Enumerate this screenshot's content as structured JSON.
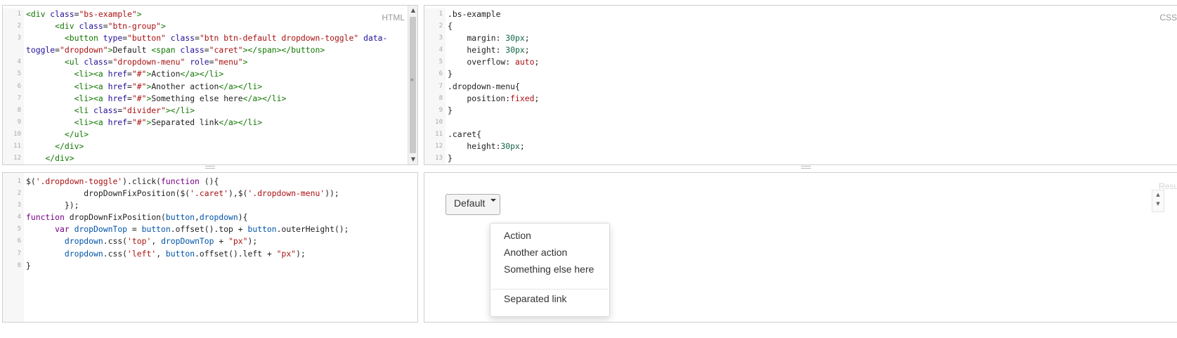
{
  "panes": {
    "html_label": "HTML",
    "css_label": "CSS",
    "result_label": "Resu"
  },
  "html_lines": [
    [
      {
        "c": "t-tag",
        "t": "<div "
      },
      {
        "c": "t-attr",
        "t": "class"
      },
      {
        "c": "t-plain",
        "t": "="
      },
      {
        "c": "t-str",
        "t": "\"bs-example\""
      },
      {
        "c": "t-tag",
        "t": ">"
      }
    ],
    [
      {
        "c": "t-plain",
        "t": "      "
      },
      {
        "c": "t-tag",
        "t": "<div "
      },
      {
        "c": "t-attr",
        "t": "class"
      },
      {
        "c": "t-plain",
        "t": "="
      },
      {
        "c": "t-str",
        "t": "\"btn-group\""
      },
      {
        "c": "t-tag",
        "t": ">"
      }
    ],
    [
      {
        "c": "t-plain",
        "t": "        "
      },
      {
        "c": "t-tag",
        "t": "<button "
      },
      {
        "c": "t-attr",
        "t": "type"
      },
      {
        "c": "t-plain",
        "t": "="
      },
      {
        "c": "t-str",
        "t": "\"button\""
      },
      {
        "c": "t-plain",
        "t": " "
      },
      {
        "c": "t-attr",
        "t": "class"
      },
      {
        "c": "t-plain",
        "t": "="
      },
      {
        "c": "t-str",
        "t": "\"btn btn-default dropdown-toggle\""
      },
      {
        "c": "t-plain",
        "t": " "
      },
      {
        "c": "t-attr",
        "t": "data-"
      }
    ],
    [
      {
        "c": "t-attr",
        "t": "toggle"
      },
      {
        "c": "t-plain",
        "t": "="
      },
      {
        "c": "t-str",
        "t": "\"dropdown\""
      },
      {
        "c": "t-tag",
        "t": ">"
      },
      {
        "c": "t-plain",
        "t": "Default "
      },
      {
        "c": "t-tag",
        "t": "<span "
      },
      {
        "c": "t-attr",
        "t": "class"
      },
      {
        "c": "t-plain",
        "t": "="
      },
      {
        "c": "t-str",
        "t": "\"caret\""
      },
      {
        "c": "t-tag",
        "t": "></span></button>"
      }
    ],
    [
      {
        "c": "t-plain",
        "t": "        "
      },
      {
        "c": "t-tag",
        "t": "<ul "
      },
      {
        "c": "t-attr",
        "t": "class"
      },
      {
        "c": "t-plain",
        "t": "="
      },
      {
        "c": "t-str",
        "t": "\"dropdown-menu\""
      },
      {
        "c": "t-plain",
        "t": " "
      },
      {
        "c": "t-attr",
        "t": "role"
      },
      {
        "c": "t-plain",
        "t": "="
      },
      {
        "c": "t-str",
        "t": "\"menu\""
      },
      {
        "c": "t-tag",
        "t": ">"
      }
    ],
    [
      {
        "c": "t-plain",
        "t": "          "
      },
      {
        "c": "t-tag",
        "t": "<li><a "
      },
      {
        "c": "t-attr",
        "t": "href"
      },
      {
        "c": "t-plain",
        "t": "="
      },
      {
        "c": "t-str",
        "t": "\"#\""
      },
      {
        "c": "t-tag",
        "t": ">"
      },
      {
        "c": "t-plain",
        "t": "Action"
      },
      {
        "c": "t-tag",
        "t": "</a></li>"
      }
    ],
    [
      {
        "c": "t-plain",
        "t": "          "
      },
      {
        "c": "t-tag",
        "t": "<li><a "
      },
      {
        "c": "t-attr",
        "t": "href"
      },
      {
        "c": "t-plain",
        "t": "="
      },
      {
        "c": "t-str",
        "t": "\"#\""
      },
      {
        "c": "t-tag",
        "t": ">"
      },
      {
        "c": "t-plain",
        "t": "Another action"
      },
      {
        "c": "t-tag",
        "t": "</a></li>"
      }
    ],
    [
      {
        "c": "t-plain",
        "t": "          "
      },
      {
        "c": "t-tag",
        "t": "<li><a "
      },
      {
        "c": "t-attr",
        "t": "href"
      },
      {
        "c": "t-plain",
        "t": "="
      },
      {
        "c": "t-str",
        "t": "\"#\""
      },
      {
        "c": "t-tag",
        "t": ">"
      },
      {
        "c": "t-plain",
        "t": "Something else here"
      },
      {
        "c": "t-tag",
        "t": "</a></li>"
      }
    ],
    [
      {
        "c": "t-plain",
        "t": "          "
      },
      {
        "c": "t-tag",
        "t": "<li "
      },
      {
        "c": "t-attr",
        "t": "class"
      },
      {
        "c": "t-plain",
        "t": "="
      },
      {
        "c": "t-str",
        "t": "\"divider\""
      },
      {
        "c": "t-tag",
        "t": "></li>"
      }
    ],
    [
      {
        "c": "t-plain",
        "t": "          "
      },
      {
        "c": "t-tag",
        "t": "<li><a "
      },
      {
        "c": "t-attr",
        "t": "href"
      },
      {
        "c": "t-plain",
        "t": "="
      },
      {
        "c": "t-str",
        "t": "\"#\""
      },
      {
        "c": "t-tag",
        "t": ">"
      },
      {
        "c": "t-plain",
        "t": "Separated link"
      },
      {
        "c": "t-tag",
        "t": "</a></li>"
      }
    ],
    [
      {
        "c": "t-plain",
        "t": "        "
      },
      {
        "c": "t-tag",
        "t": "</ul>"
      }
    ],
    [
      {
        "c": "t-plain",
        "t": "      "
      },
      {
        "c": "t-tag",
        "t": "</div>"
      }
    ],
    [
      {
        "c": "t-plain",
        "t": "    "
      },
      {
        "c": "t-tag",
        "t": "</div>"
      }
    ]
  ],
  "html_line_numbers": [
    "1",
    "2",
    "3",
    "",
    "4",
    "5",
    "6",
    "7",
    "8",
    "9",
    "10",
    "11",
    "12"
  ],
  "css_lines": [
    [
      {
        "c": "t-plain",
        "t": ".bs-example"
      }
    ],
    [
      {
        "c": "t-plain",
        "t": "{"
      }
    ],
    [
      {
        "c": "t-plain",
        "t": "    margin: "
      },
      {
        "c": "t-num",
        "t": "30px"
      },
      {
        "c": "t-plain",
        "t": ";"
      }
    ],
    [
      {
        "c": "t-plain",
        "t": "    height: "
      },
      {
        "c": "t-num",
        "t": "30px"
      },
      {
        "c": "t-plain",
        "t": ";"
      }
    ],
    [
      {
        "c": "t-plain",
        "t": "    overflow: "
      },
      {
        "c": "t-str",
        "t": "auto"
      },
      {
        "c": "t-plain",
        "t": ";"
      }
    ],
    [
      {
        "c": "t-plain",
        "t": "}"
      }
    ],
    [
      {
        "c": "t-plain",
        "t": ".dropdown-menu{"
      }
    ],
    [
      {
        "c": "t-plain",
        "t": "    position:"
      },
      {
        "c": "t-str",
        "t": "fixed"
      },
      {
        "c": "t-plain",
        "t": ";"
      }
    ],
    [
      {
        "c": "t-plain",
        "t": "}"
      }
    ],
    [
      {
        "c": "t-plain",
        "t": ""
      }
    ],
    [
      {
        "c": "t-plain",
        "t": ".caret{"
      }
    ],
    [
      {
        "c": "t-plain",
        "t": "    height:"
      },
      {
        "c": "t-num",
        "t": "30px"
      },
      {
        "c": "t-plain",
        "t": ";"
      }
    ],
    [
      {
        "c": "t-plain",
        "t": "}"
      }
    ]
  ],
  "css_line_numbers": [
    "1",
    "2",
    "3",
    "4",
    "5",
    "6",
    "7",
    "8",
    "9",
    "10",
    "11",
    "12",
    "13"
  ],
  "js_lines": [
    [
      {
        "c": "t-plain",
        "t": "$("
      },
      {
        "c": "t-str",
        "t": "'.dropdown-toggle'"
      },
      {
        "c": "t-plain",
        "t": ").click("
      },
      {
        "c": "t-kw",
        "t": "function"
      },
      {
        "c": "t-plain",
        "t": " (){"
      }
    ],
    [
      {
        "c": "t-plain",
        "t": "            dropDownFixPosition($("
      },
      {
        "c": "t-str",
        "t": "'.caret'"
      },
      {
        "c": "t-plain",
        "t": "),$("
      },
      {
        "c": "t-str",
        "t": "'.dropdown-menu'"
      },
      {
        "c": "t-plain",
        "t": "));"
      }
    ],
    [
      {
        "c": "t-plain",
        "t": "        });"
      }
    ],
    [
      {
        "c": "t-kw",
        "t": "function"
      },
      {
        "c": "t-plain",
        "t": " dropDownFixPosition("
      },
      {
        "c": "t-var",
        "t": "button"
      },
      {
        "c": "t-plain",
        "t": ","
      },
      {
        "c": "t-var",
        "t": "dropdown"
      },
      {
        "c": "t-plain",
        "t": "){"
      }
    ],
    [
      {
        "c": "t-plain",
        "t": "      "
      },
      {
        "c": "t-kw",
        "t": "var"
      },
      {
        "c": "t-plain",
        "t": " "
      },
      {
        "c": "t-var",
        "t": "dropDownTop"
      },
      {
        "c": "t-plain",
        "t": " = "
      },
      {
        "c": "t-var",
        "t": "button"
      },
      {
        "c": "t-plain",
        "t": ".offset().top + "
      },
      {
        "c": "t-var",
        "t": "button"
      },
      {
        "c": "t-plain",
        "t": ".outerHeight();"
      }
    ],
    [
      {
        "c": "t-plain",
        "t": "        "
      },
      {
        "c": "t-var",
        "t": "dropdown"
      },
      {
        "c": "t-plain",
        "t": ".css("
      },
      {
        "c": "t-str",
        "t": "'top'"
      },
      {
        "c": "t-plain",
        "t": ", "
      },
      {
        "c": "t-var",
        "t": "dropDownTop"
      },
      {
        "c": "t-plain",
        "t": " + "
      },
      {
        "c": "t-str",
        "t": "\"px\""
      },
      {
        "c": "t-plain",
        "t": ");"
      }
    ],
    [
      {
        "c": "t-plain",
        "t": "        "
      },
      {
        "c": "t-var",
        "t": "dropdown"
      },
      {
        "c": "t-plain",
        "t": ".css("
      },
      {
        "c": "t-str",
        "t": "'left'"
      },
      {
        "c": "t-plain",
        "t": ", "
      },
      {
        "c": "t-var",
        "t": "button"
      },
      {
        "c": "t-plain",
        "t": ".offset().left + "
      },
      {
        "c": "t-str",
        "t": "\"px\""
      },
      {
        "c": "t-plain",
        "t": ");"
      }
    ],
    [
      {
        "c": "t-plain",
        "t": "}"
      }
    ]
  ],
  "js_line_numbers": [
    "1",
    "2",
    "3",
    "4",
    "5",
    "6",
    "7",
    "8"
  ],
  "result": {
    "button_label": "Default",
    "menu_items": [
      "Action",
      "Another action",
      "Something else here"
    ],
    "separated_item": "Separated link"
  },
  "icons": {
    "scroll_up": "scroll-up-arrow-icon",
    "scroll_down": "scroll-down-arrow-icon",
    "caret": "caret-down-icon"
  }
}
